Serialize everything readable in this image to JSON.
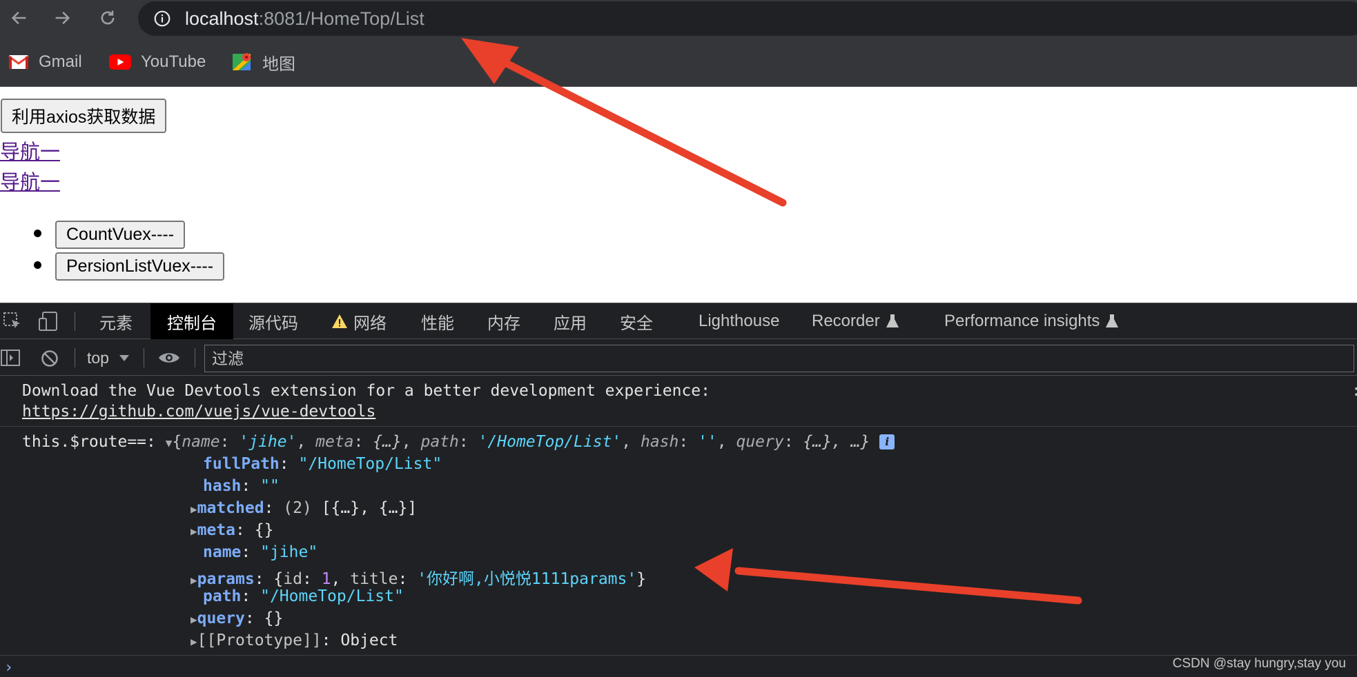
{
  "browser": {
    "url_host": "localhost",
    "url_rest": ":8081/HomeTop/List",
    "bookmarks": [
      {
        "label": "Gmail",
        "icon": "gmail-icon"
      },
      {
        "label": "YouTube",
        "icon": "youtube-icon"
      },
      {
        "label": "地图",
        "icon": "maps-icon"
      }
    ]
  },
  "page": {
    "fetch_button": "利用axios获取数据",
    "links": [
      "导航一",
      "导航一"
    ],
    "list_buttons": [
      "CountVuex----",
      "PersionListVuex----"
    ]
  },
  "devtools": {
    "tabs": [
      "元素",
      "控制台",
      "源代码",
      "网络",
      "性能",
      "内存",
      "应用",
      "安全",
      "Lighthouse",
      "Recorder",
      "Performance insights"
    ],
    "active_tab": "控制台",
    "context": "top",
    "filter_placeholder": "过滤"
  },
  "console": {
    "vue_msg": "Download the Vue Devtools extension for a better development experience:",
    "vue_link": "https://github.com/vuejs/vue-devtools",
    "log_prefix": "this.$route==:",
    "summary": {
      "name_key": "name",
      "name_val": "'jihe'",
      "meta_key": "meta",
      "meta_val": "{…}",
      "path_key": "path",
      "path_val": "'/HomeTop/List'",
      "hash_key": "hash",
      "hash_val": "''",
      "query_key": "query",
      "query_val": "{…}",
      "tail": ", …}"
    },
    "props": {
      "fullPath_key": "fullPath",
      "fullPath_val": "\"/HomeTop/List\"",
      "hash_key": "hash",
      "hash_val": "\"\"",
      "matched_key": "matched",
      "matched_count": "(2)",
      "matched_val": "[{…}, {…}]",
      "meta_key": "meta",
      "meta_val": "{}",
      "name_key": "name",
      "name_val": "\"jihe\"",
      "params_key": "params",
      "params_id_key": "id",
      "params_id_val": "1",
      "params_title_key": "title",
      "params_title_val": "'你好啊,小悦悦1111params'",
      "path_key": "path",
      "path_val": "\"/HomeTop/List\"",
      "query_key": "query",
      "query_val": "{}",
      "proto_key": "[[Prototype]]",
      "proto_val": "Object"
    }
  },
  "watermark": "CSDN @stay hungry,stay you",
  "colors": {
    "annotation_arrow": "#e8402a",
    "chrome_bg": "#35363a",
    "devtools_bg": "#202124",
    "link": "#551a8b"
  }
}
